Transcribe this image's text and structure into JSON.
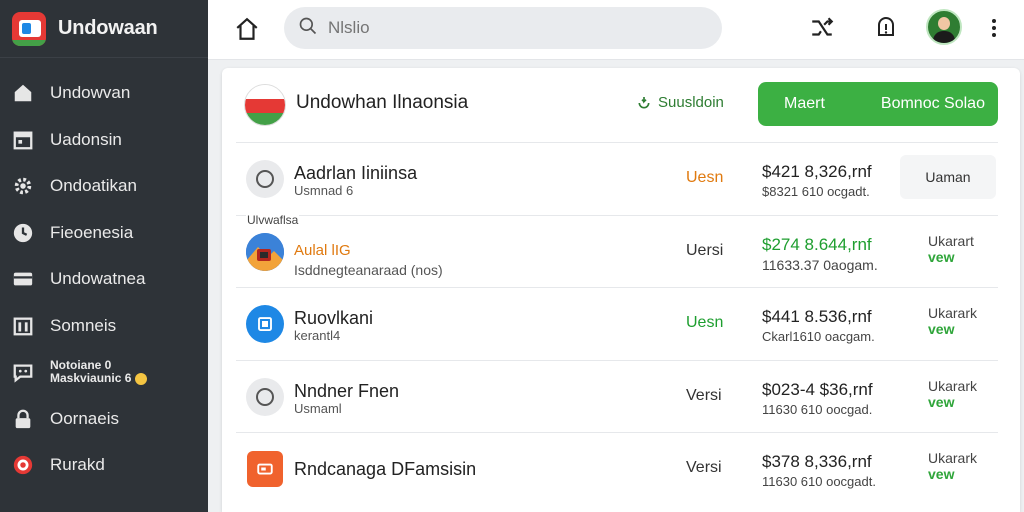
{
  "brand": {
    "title": "Undowaan"
  },
  "sidebar": {
    "items": [
      {
        "label": "Undowvan",
        "icon": "home-icon"
      },
      {
        "label": "Uadonsin",
        "icon": "calendar-icon"
      },
      {
        "label": "Ondoatikan",
        "icon": "gear-icon"
      },
      {
        "label": "Fieoenesia",
        "icon": "clock-icon"
      },
      {
        "label": "Undowatnea",
        "icon": "card-icon"
      },
      {
        "label": "Somneis",
        "icon": "bank-icon"
      },
      {
        "label_line1": "Notoiane 0",
        "label_line2": "Maskviaunic 6",
        "icon": "chat-icon"
      },
      {
        "label": "Oornaeis",
        "icon": "lock-icon"
      },
      {
        "label": "Rurakd",
        "icon": "target-icon"
      }
    ]
  },
  "search": {
    "placeholder": "Nlslio"
  },
  "panel": {
    "title": "Undowhan Ilnaonsia",
    "sub_link": "Suusldoin",
    "button_left": "Maert",
    "button_right": "Bomnoc Solao"
  },
  "rows": [
    {
      "icon": "circle-icon",
      "name": "Aadrlan Iiniinsa",
      "sub": "Usmnad 6",
      "status": "Uesn",
      "status_color": "#e07a10",
      "amount": "$421 8,326,rnf",
      "amount_sub": "$8321 610 ocgadt.",
      "action": "Uaman",
      "action_style": "box"
    },
    {
      "tag": "Ulvwaflsa",
      "icon": "photo-icon",
      "name": "Aulal lIG",
      "sub": "Isddnegteanaraad (nos)",
      "status": "Uersi",
      "status_color": "#333333",
      "amount": "$274 8.644,rnf",
      "amount_sub": "11633.37 0aogam.",
      "amount_green": true,
      "action_line1": "Ukarart",
      "action_line2": "vew"
    },
    {
      "icon": "square-icon",
      "name": "Ruovlkani",
      "sub": "kerantl4",
      "status": "Uesn",
      "status_color": "#1e9e2f",
      "amount": "$441 8.536,rnf",
      "amount_sub": "Ckarl1610 oacgam.",
      "action_line1": "Ukarark",
      "action_line2": "vew"
    },
    {
      "icon": "circle-icon",
      "name": "Nndner Fnen",
      "sub": "Usmaml",
      "status": "Versi",
      "status_color": "#333333",
      "amount": "$023-4 $36,rnf",
      "amount_sub": "11630 610 oocgad.",
      "action_line1": "Ukarark",
      "action_line2": "vew"
    },
    {
      "icon": "orange-square-icon",
      "name": "Rndcanaga DFamsisin",
      "sub": "",
      "status": "Versi",
      "status_color": "#333333",
      "amount": "$378 8,336,rnf",
      "amount_sub": "11630 610 oocgadt.",
      "action_line1": "Ukarark",
      "action_line2": "vew"
    }
  ]
}
